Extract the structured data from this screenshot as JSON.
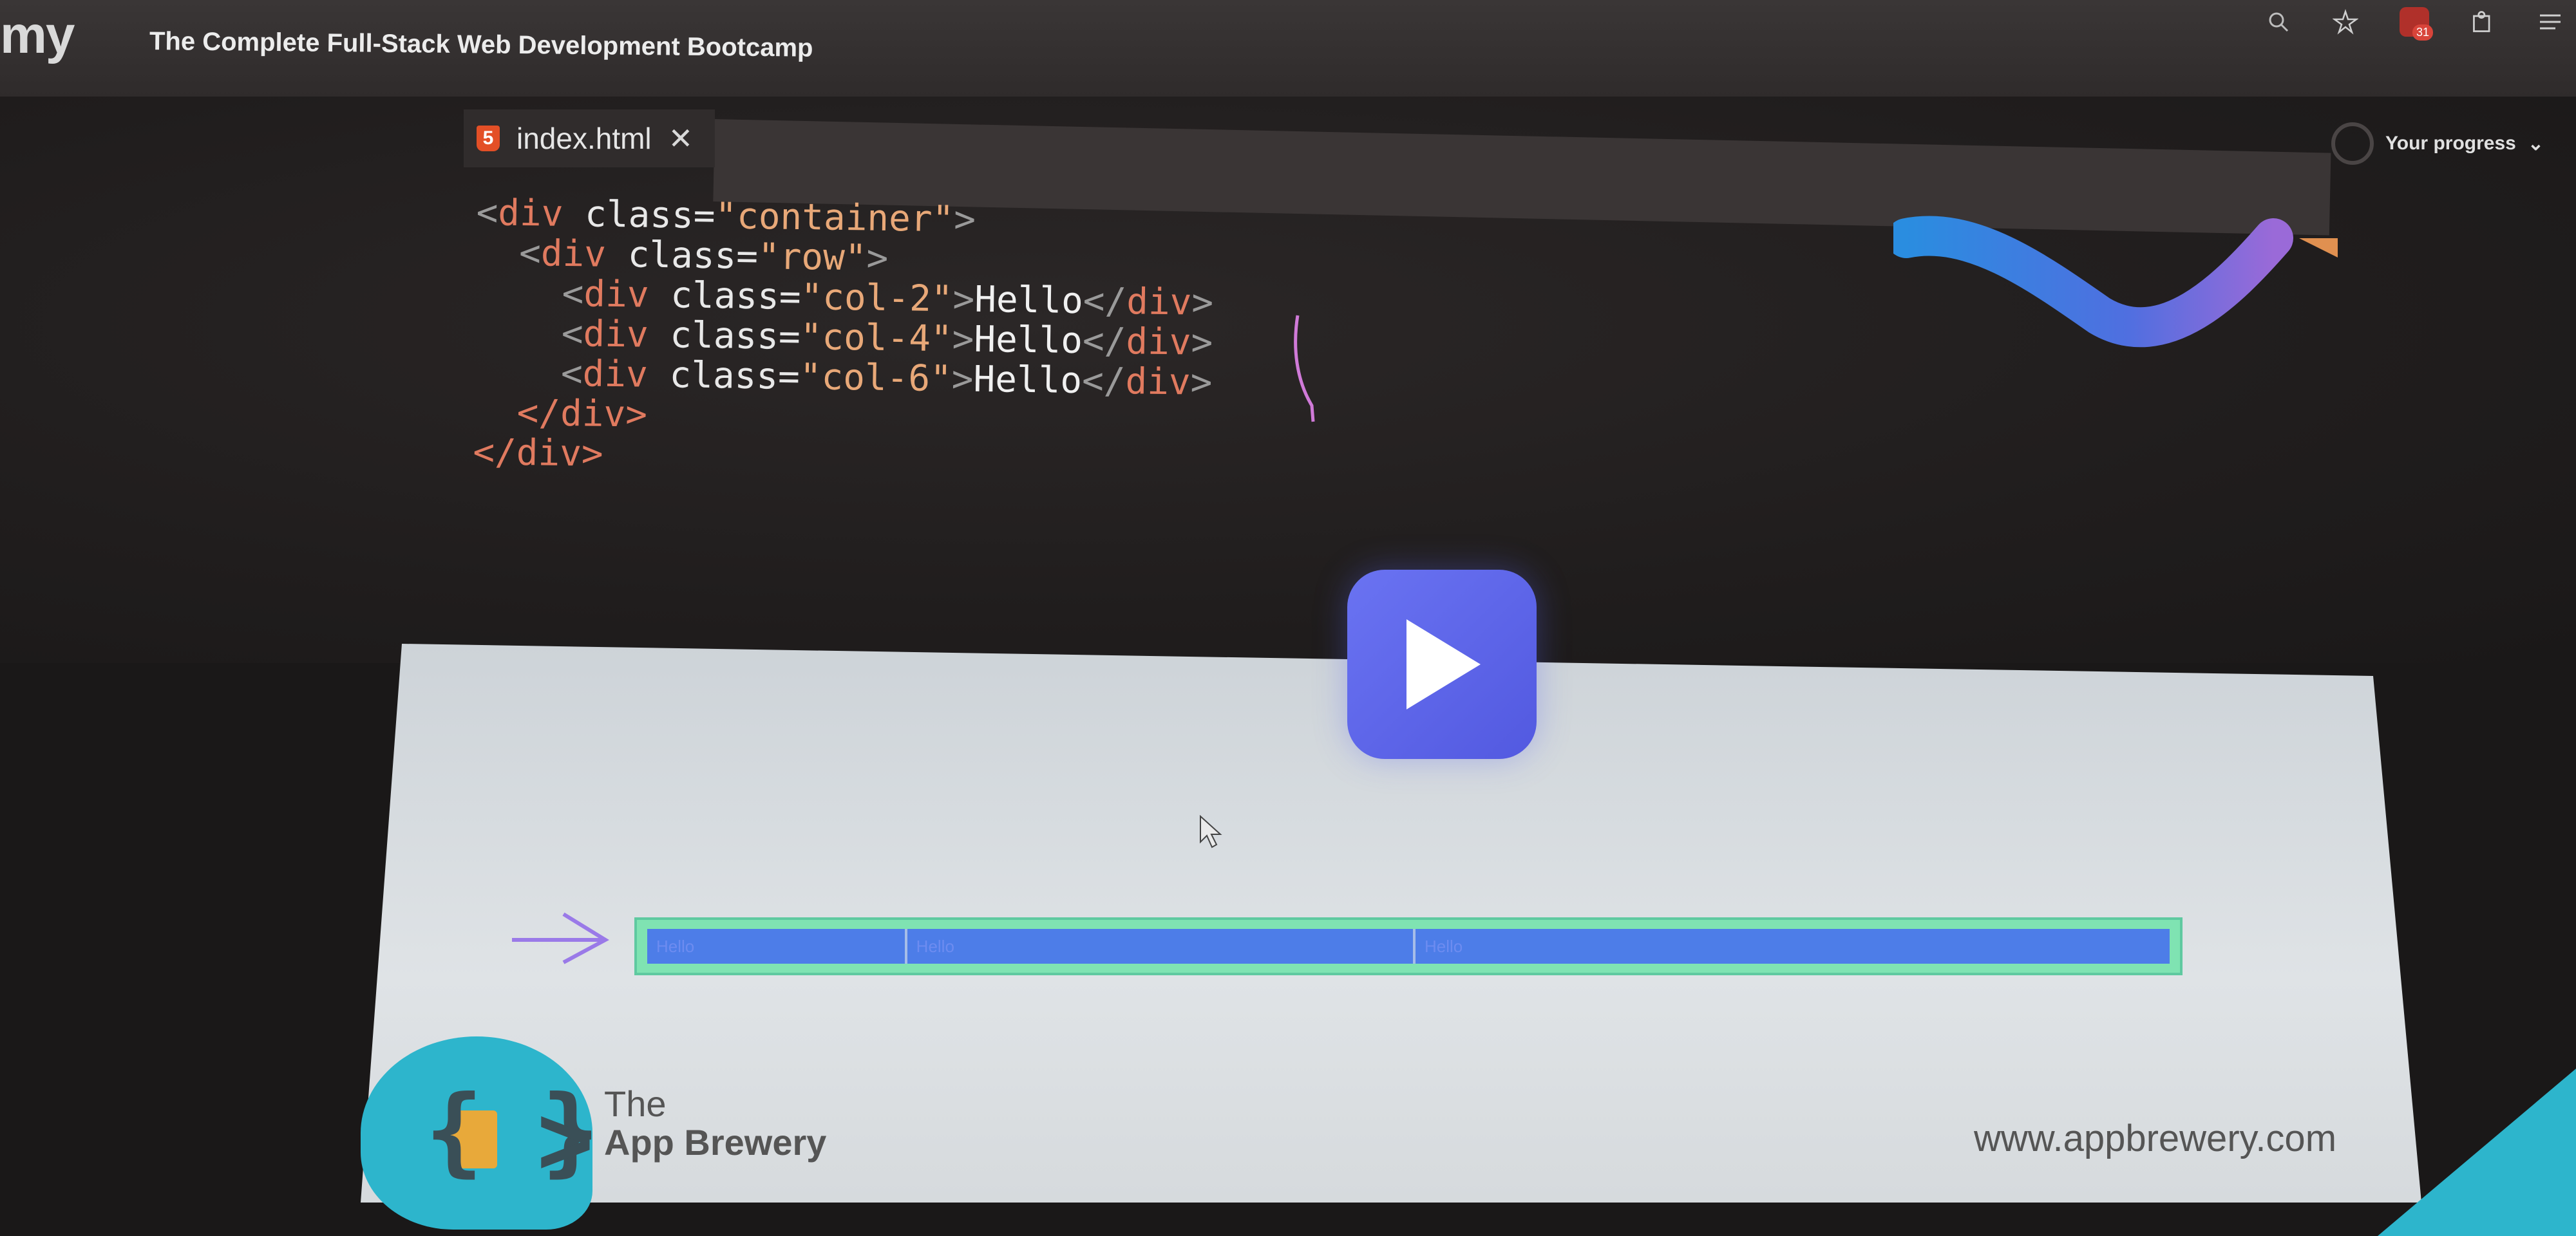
{
  "app": {
    "brand": "my",
    "course_title": "The Complete Full-Stack Web Development Bootcamp"
  },
  "top_icons": [
    "search-icon",
    "star-icon",
    "extension-icon",
    "puzzle-icon",
    "menu-icon"
  ],
  "notification_badge": "31",
  "editor": {
    "tab": {
      "label": "index.html",
      "close": "✕",
      "icon": "html5-icon"
    },
    "code_lines": [
      {
        "indent": "",
        "tag": "div",
        "attr": "class",
        "value": "\"container\"",
        "close": false
      },
      {
        "indent": "  ",
        "tag": "div",
        "attr": "class",
        "value": "\"row\"",
        "close": false
      },
      {
        "indent": "    ",
        "tag": "div",
        "attr": "class",
        "value": "\"col-2\"",
        "text": "Hello",
        "close": true
      },
      {
        "indent": "    ",
        "tag": "div",
        "attr": "class",
        "value": "\"col-4\"",
        "text": "Hello",
        "close": true
      },
      {
        "indent": "    ",
        "tag": "div",
        "attr": "class",
        "value": "\"col-6\"",
        "text": "Hello",
        "close": true
      },
      {
        "indent": "  ",
        "end": "</div>"
      },
      {
        "indent": "",
        "end": "</div>"
      }
    ]
  },
  "progress": {
    "label": "Your progress",
    "chevron": "⌄"
  },
  "preview": {
    "columns": [
      {
        "span": 2,
        "text": "Hello"
      },
      {
        "span": 4,
        "text": "Hello"
      },
      {
        "span": 6,
        "text": "Hello"
      }
    ]
  },
  "footer": {
    "logo_the": "The",
    "logo_name": "App Brewery",
    "url": "www.appbrewery.com"
  },
  "colors": {
    "play_button": "#5a62ea",
    "row_border": "#7fe3b2",
    "column_fill": "#4d7de8",
    "html5_badge": "#e34f26",
    "accent_teal": "#2db5cc"
  }
}
